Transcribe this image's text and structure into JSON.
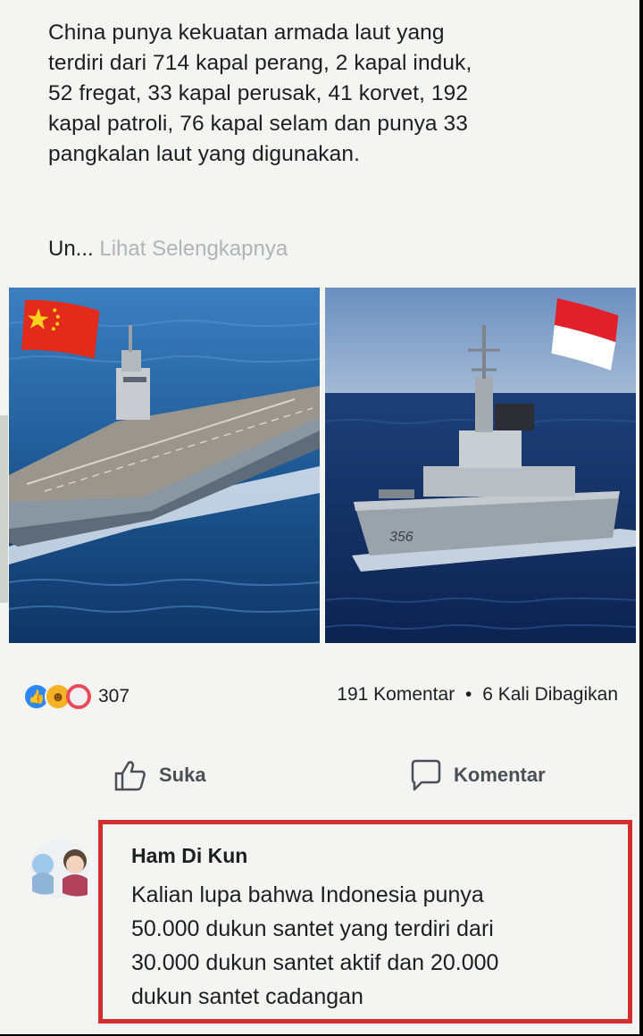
{
  "post": {
    "text_lines": [
      "China punya kekuatan armada laut yang",
      "terdiri dari 714 kapal perang, 2  kapal induk,",
      "52 fregat, 33 kapal perusak, 41 korvet, 192",
      "kapal patroli, 76 kapal selam dan punya 33",
      "pangkalan laut yang digunakan."
    ],
    "truncated": "Un...",
    "see_more": "Lihat Selengkapnya",
    "ship_number": "356"
  },
  "engagement": {
    "reaction_count": "307",
    "comments": "191 Komentar",
    "separator": "•",
    "shares": "6 Kali Dibagikan"
  },
  "actions": {
    "like_label": "Suka",
    "comment_label": "Komentar"
  },
  "comment": {
    "author": "Ham Di Kun",
    "text_lines": [
      "Kalian lupa bahwa Indonesia punya",
      "50.000 dukun santet yang terdiri dari",
      "30.000 dukun santet aktif dan 20.000",
      "dukun santet cadangan"
    ]
  },
  "icons": {
    "reactions": [
      "like-icon",
      "haha-icon",
      "love-icon"
    ],
    "like_action": "thumbs-up-icon",
    "comment_action": "speech-bubble-icon"
  },
  "colors": {
    "highlight_border": "#d32f2f",
    "see_more": "#b0b3b8",
    "like_blue": "#2d88ff"
  }
}
